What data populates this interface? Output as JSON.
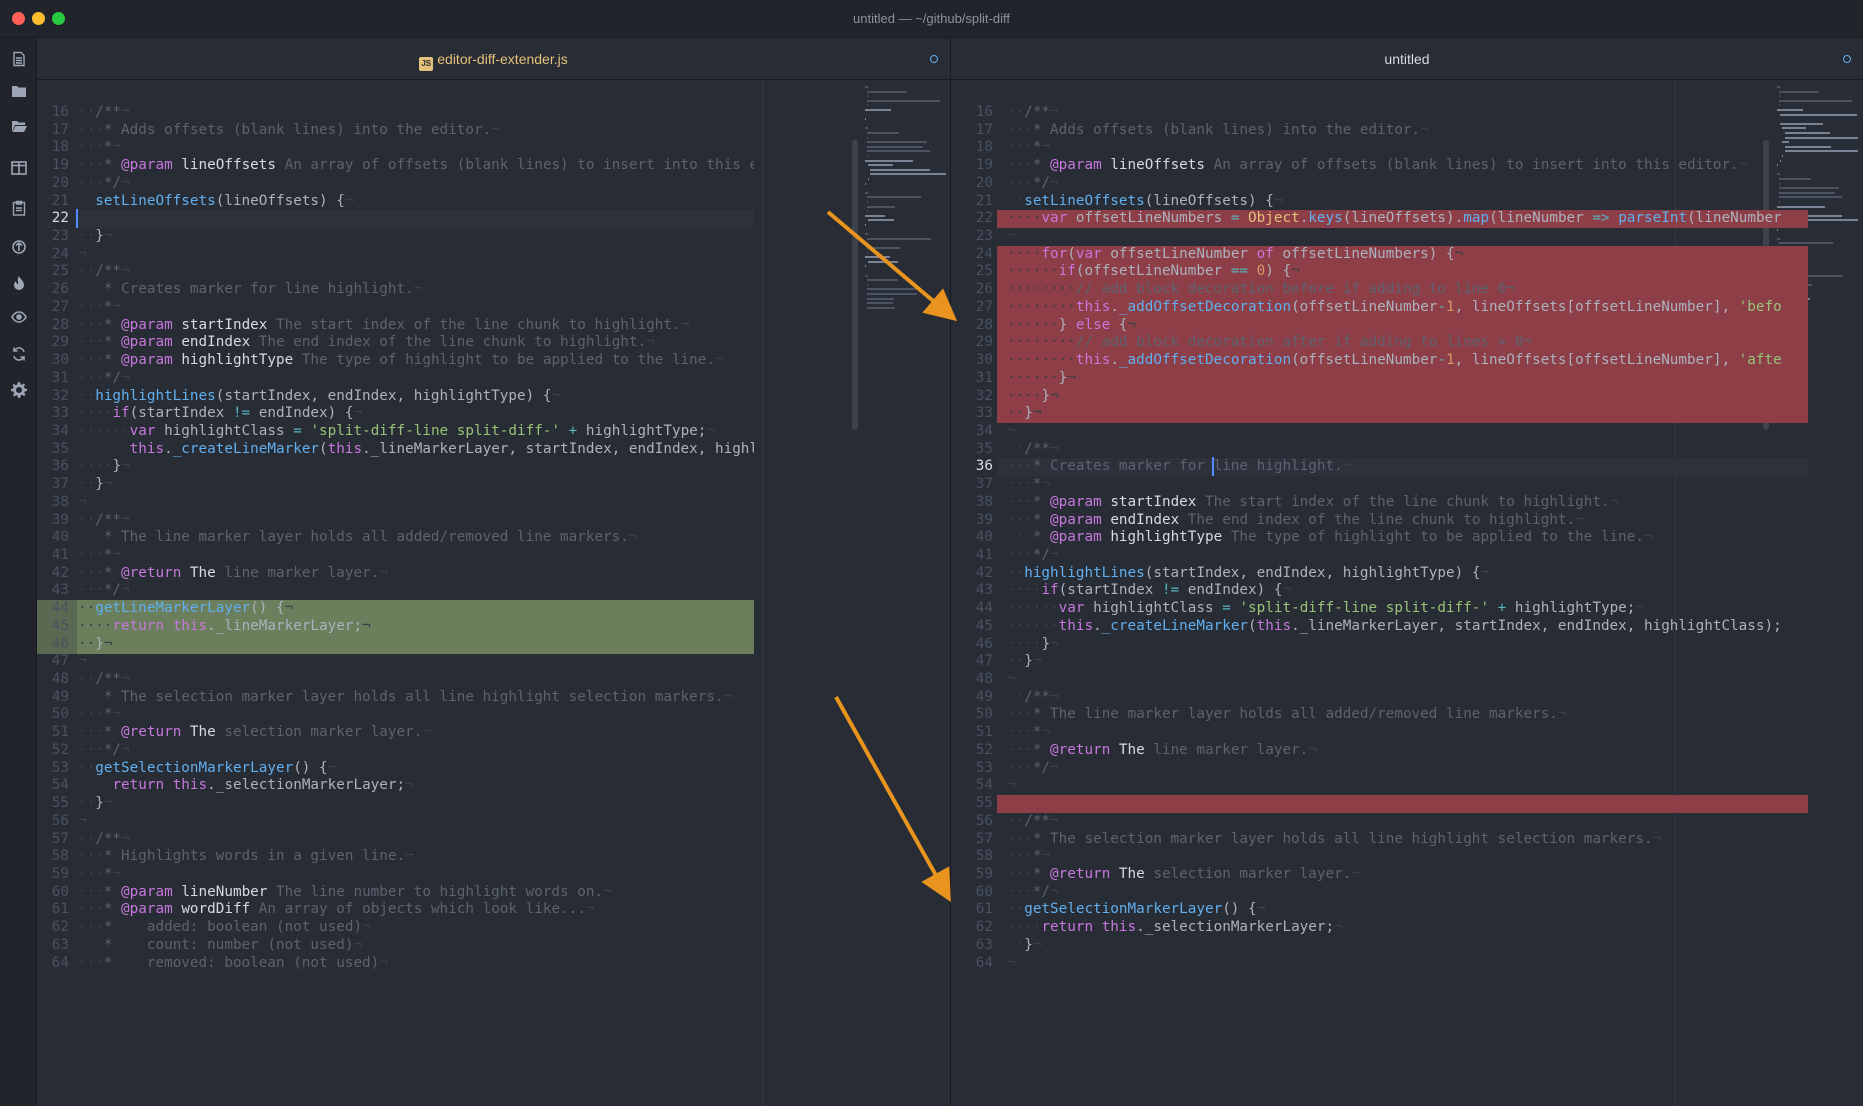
{
  "window": {
    "title": "untitled — ~/github/split-diff"
  },
  "sidebar": {
    "icons": [
      "file-icon",
      "folder-icon",
      "folder-open-icon",
      "split-panes-icon",
      "clipboard-icon",
      "git-icon",
      "flame-icon",
      "eye-icon",
      "sync-icon",
      "gear-icon"
    ]
  },
  "colors": {
    "red_close": "#ff5f57",
    "yellow_min": "#febc2e",
    "green_max": "#28c840",
    "added": "#6b7f5c",
    "removed": "#8d3e46",
    "accent": "#e8941e"
  },
  "left": {
    "tab": "editor-diff-extender.js",
    "cursor_line": 22,
    "added_lines": [
      44,
      45,
      46
    ],
    "lines": [
      {
        "n": 16,
        "t": "··/**¬"
      },
      {
        "n": 17,
        "t": "···* Adds offsets (blank lines) into the editor.¬"
      },
      {
        "n": 18,
        "t": "···*¬"
      },
      {
        "n": 19,
        "t": "···* @param lineOffsets An array of offsets (blank lines) to insert into this editor.¬"
      },
      {
        "n": 20,
        "t": "···*/¬"
      },
      {
        "n": 21,
        "t": "··setLineOffsets(lineOffsets) {¬"
      },
      {
        "n": 22,
        "t": ""
      },
      {
        "n": 23,
        "t": "··}¬"
      },
      {
        "n": 24,
        "t": "¬"
      },
      {
        "n": 25,
        "t": "··/**¬"
      },
      {
        "n": 26,
        "t": "···* Creates marker for line highlight.¬"
      },
      {
        "n": 27,
        "t": "···*¬"
      },
      {
        "n": 28,
        "t": "···* @param startIndex The start index of the line chunk to highlight.¬"
      },
      {
        "n": 29,
        "t": "···* @param endIndex The end index of the line chunk to highlight.¬"
      },
      {
        "n": 30,
        "t": "···* @param highlightType The type of highlight to be applied to the line.¬"
      },
      {
        "n": 31,
        "t": "···*/¬"
      },
      {
        "n": 32,
        "t": "··highlightLines(startIndex, endIndex, highlightType) {¬"
      },
      {
        "n": 33,
        "t": "····if(startIndex != endIndex) {¬"
      },
      {
        "n": 34,
        "t": "······var highlightClass = 'split-diff-line split-diff-' + highlightType;¬"
      },
      {
        "n": 35,
        "t": "······this._createLineMarker(this._lineMarkerLayer, startIndex, endIndex, highlightClass);¬"
      },
      {
        "n": 36,
        "t": "····}¬"
      },
      {
        "n": 37,
        "t": "··}¬"
      },
      {
        "n": 38,
        "t": "¬"
      },
      {
        "n": 39,
        "t": "··/**¬"
      },
      {
        "n": 40,
        "t": "···* The line marker layer holds all added/removed line markers.¬"
      },
      {
        "n": 41,
        "t": "···*¬"
      },
      {
        "n": 42,
        "t": "···* @return The line marker layer.¬"
      },
      {
        "n": 43,
        "t": "···*/¬"
      },
      {
        "n": 44,
        "t": "··getLineMarkerLayer() {¬"
      },
      {
        "n": 45,
        "t": "····return this._lineMarkerLayer;¬"
      },
      {
        "n": 46,
        "t": "··}¬"
      },
      {
        "n": 47,
        "t": "¬"
      },
      {
        "n": 48,
        "t": "··/**¬"
      },
      {
        "n": 49,
        "t": "···* The selection marker layer holds all line highlight selection markers.¬"
      },
      {
        "n": 50,
        "t": "···*¬"
      },
      {
        "n": 51,
        "t": "···* @return The selection marker layer.¬"
      },
      {
        "n": 52,
        "t": "···*/¬"
      },
      {
        "n": 53,
        "t": "··getSelectionMarkerLayer() {¬"
      },
      {
        "n": 54,
        "t": "····return this._selectionMarkerLayer;¬"
      },
      {
        "n": 55,
        "t": "··}¬"
      },
      {
        "n": 56,
        "t": "¬"
      },
      {
        "n": 57,
        "t": "··/**¬"
      },
      {
        "n": 58,
        "t": "···* Highlights words in a given line.¬"
      },
      {
        "n": 59,
        "t": "···*¬"
      },
      {
        "n": 60,
        "t": "···* @param lineNumber The line number to highlight words on.¬"
      },
      {
        "n": 61,
        "t": "···* @param wordDiff An array of objects which look like...¬"
      },
      {
        "n": 62,
        "t": "···*    added: boolean (not used)¬"
      },
      {
        "n": 63,
        "t": "···*    count: number (not used)¬"
      },
      {
        "n": 64,
        "t": "···*    removed: boolean (not used)¬"
      }
    ]
  },
  "right": {
    "tab": "untitled",
    "cursor_line": 36,
    "removed_lines": [
      22,
      24,
      25,
      26,
      27,
      28,
      29,
      30,
      31,
      32,
      33,
      55
    ],
    "lines": [
      {
        "n": 16,
        "t": "··/**¬"
      },
      {
        "n": 17,
        "t": "···* Adds offsets (blank lines) into the editor.¬"
      },
      {
        "n": 18,
        "t": "···*¬"
      },
      {
        "n": 19,
        "t": "···* @param lineOffsets An array of offsets (blank lines) to insert into this editor.¬"
      },
      {
        "n": 20,
        "t": "···*/¬"
      },
      {
        "n": 21,
        "t": "··setLineOffsets(lineOffsets) {¬"
      },
      {
        "n": 22,
        "t": "····var offsetLineNumbers = Object.keys(lineOffsets).map(lineNumber => parseInt(lineNumber"
      },
      {
        "n": 23,
        "t": "¬"
      },
      {
        "n": 24,
        "t": "····for(var offsetLineNumber of offsetLineNumbers) {¬"
      },
      {
        "n": 25,
        "t": "······if(offsetLineNumber == 0) {¬"
      },
      {
        "n": 26,
        "t": "········// add block decoration before if adding to line 0¬"
      },
      {
        "n": 27,
        "t": "········this._addOffsetDecoration(offsetLineNumber-1, lineOffsets[offsetLineNumber], 'befo"
      },
      {
        "n": 28,
        "t": "······} else {¬"
      },
      {
        "n": 29,
        "t": "········// add block decoration after if adding to lines > 0¬"
      },
      {
        "n": 30,
        "t": "········this._addOffsetDecoration(offsetLineNumber-1, lineOffsets[offsetLineNumber], 'afte"
      },
      {
        "n": 31,
        "t": "······}¬"
      },
      {
        "n": 32,
        "t": "····}¬"
      },
      {
        "n": 33,
        "t": "··}¬"
      },
      {
        "n": 34,
        "t": "¬"
      },
      {
        "n": 35,
        "t": "··/**¬"
      },
      {
        "n": 36,
        "t": "···* Creates marker for line highlight.¬"
      },
      {
        "n": 37,
        "t": "···*¬"
      },
      {
        "n": 38,
        "t": "···* @param startIndex The start index of the line chunk to highlight.¬"
      },
      {
        "n": 39,
        "t": "···* @param endIndex The end index of the line chunk to highlight.¬"
      },
      {
        "n": 40,
        "t": "···* @param highlightType The type of highlight to be applied to the line.¬"
      },
      {
        "n": 41,
        "t": "···*/¬"
      },
      {
        "n": 42,
        "t": "··highlightLines(startIndex, endIndex, highlightType) {¬"
      },
      {
        "n": 43,
        "t": "····if(startIndex != endIndex) {¬"
      },
      {
        "n": 44,
        "t": "······var highlightClass = 'split-diff-line split-diff-' + highlightType;¬"
      },
      {
        "n": 45,
        "t": "······this._createLineMarker(this._lineMarkerLayer, startIndex, endIndex, highlightClass);"
      },
      {
        "n": 46,
        "t": "····}¬"
      },
      {
        "n": 47,
        "t": "··}¬"
      },
      {
        "n": 48,
        "t": "¬"
      },
      {
        "n": 49,
        "t": "··/**¬"
      },
      {
        "n": 50,
        "t": "···* The line marker layer holds all added/removed line markers.¬"
      },
      {
        "n": 51,
        "t": "···*¬"
      },
      {
        "n": 52,
        "t": "···* @return The line marker layer.¬"
      },
      {
        "n": 53,
        "t": "···*/¬"
      },
      {
        "n": 54,
        "t": "¬"
      },
      {
        "n": 55,
        "t": ""
      },
      {
        "n": 56,
        "t": "··/**¬"
      },
      {
        "n": 57,
        "t": "···* The selection marker layer holds all line highlight selection markers.¬"
      },
      {
        "n": 58,
        "t": "···*¬"
      },
      {
        "n": 59,
        "t": "···* @return The selection marker layer.¬"
      },
      {
        "n": 60,
        "t": "···*/¬"
      },
      {
        "n": 61,
        "t": "··getSelectionMarkerLayer() {¬"
      },
      {
        "n": 62,
        "t": "····return this._selectionMarkerLayer;¬"
      },
      {
        "n": 63,
        "t": "··}¬"
      },
      {
        "n": 64,
        "t": "¬"
      }
    ]
  }
}
